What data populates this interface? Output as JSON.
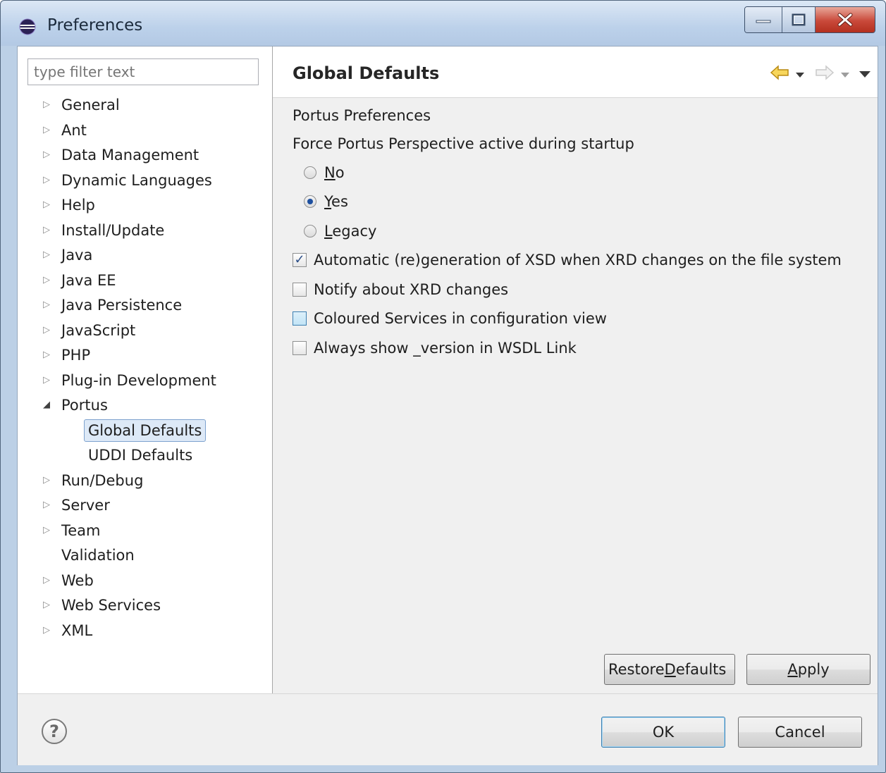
{
  "window": {
    "title": "Preferences",
    "icon": "eclipse-icon"
  },
  "filter": {
    "placeholder": "type filter text"
  },
  "tree": {
    "items": [
      {
        "label": "General",
        "state": "collapsed"
      },
      {
        "label": "Ant",
        "state": "collapsed"
      },
      {
        "label": "Data Management",
        "state": "collapsed"
      },
      {
        "label": "Dynamic Languages",
        "state": "collapsed"
      },
      {
        "label": "Help",
        "state": "collapsed"
      },
      {
        "label": "Install/Update",
        "state": "collapsed"
      },
      {
        "label": "Java",
        "state": "collapsed"
      },
      {
        "label": "Java EE",
        "state": "collapsed"
      },
      {
        "label": "Java Persistence",
        "state": "collapsed"
      },
      {
        "label": "JavaScript",
        "state": "collapsed"
      },
      {
        "label": "PHP",
        "state": "collapsed"
      },
      {
        "label": "Plug-in Development",
        "state": "collapsed"
      },
      {
        "label": "Portus",
        "state": "expanded"
      },
      {
        "label": "Global Defaults",
        "state": "child-selected"
      },
      {
        "label": "UDDI Defaults",
        "state": "child"
      },
      {
        "label": "Run/Debug",
        "state": "collapsed"
      },
      {
        "label": "Server",
        "state": "collapsed"
      },
      {
        "label": "Team",
        "state": "collapsed"
      },
      {
        "label": "Validation",
        "state": "leaf"
      },
      {
        "label": "Web",
        "state": "collapsed"
      },
      {
        "label": "Web Services",
        "state": "collapsed"
      },
      {
        "label": "XML",
        "state": "collapsed"
      }
    ]
  },
  "page": {
    "title": "Global Defaults",
    "section": "Portus Preferences",
    "perspective_label": "Force Portus Perspective active during startup",
    "radios": [
      {
        "mnemonic": "N",
        "rest": "o",
        "checked": false
      },
      {
        "mnemonic": "Y",
        "rest": "es",
        "checked": true
      },
      {
        "mnemonic": "L",
        "rest": "egacy",
        "checked": false
      }
    ],
    "checkboxes": [
      {
        "label": "Automatic (re)generation of XSD when XRD changes on the file system",
        "checked": true
      },
      {
        "label": "Notify about XRD changes",
        "checked": false
      },
      {
        "label": "Coloured Services in configuration view",
        "checked": false
      },
      {
        "label": "Always show _version in WSDL Link",
        "checked": false
      }
    ],
    "restore_pre": "Restore ",
    "restore_mnemonic": "D",
    "restore_post": "efaults",
    "apply_mnemonic": "A",
    "apply_post": "pply"
  },
  "footer": {
    "ok_label": "OK",
    "cancel_label": "Cancel"
  },
  "colors": {
    "accent": "#3c7fb1",
    "selection": "#dde9f7",
    "nav_back": "#e8b83a"
  }
}
